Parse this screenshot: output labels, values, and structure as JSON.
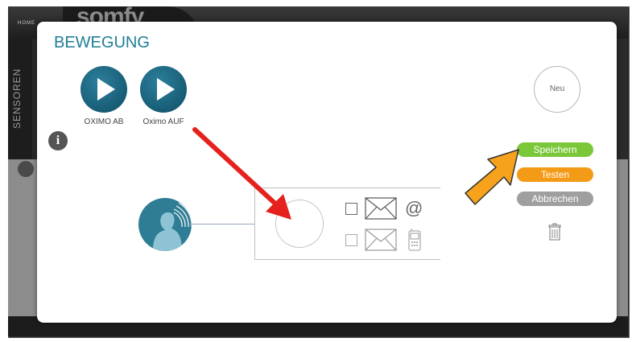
{
  "background_app": {
    "home_label": "HOME",
    "logo": "somfy",
    "sidebar_label": "SENSOREN"
  },
  "modal": {
    "title": "BEWEGUNG",
    "actions": [
      {
        "label": "OXIMO AB"
      },
      {
        "label": "Oximo AUF"
      }
    ],
    "new_label": "Neu",
    "buttons": {
      "save": "Speichern",
      "test": "Testen",
      "cancel": "Abbrechen"
    },
    "colors": {
      "accent": "#1e7f97",
      "save": "#7ac83a",
      "test": "#f39a16",
      "cancel": "#9f9f9f"
    }
  }
}
